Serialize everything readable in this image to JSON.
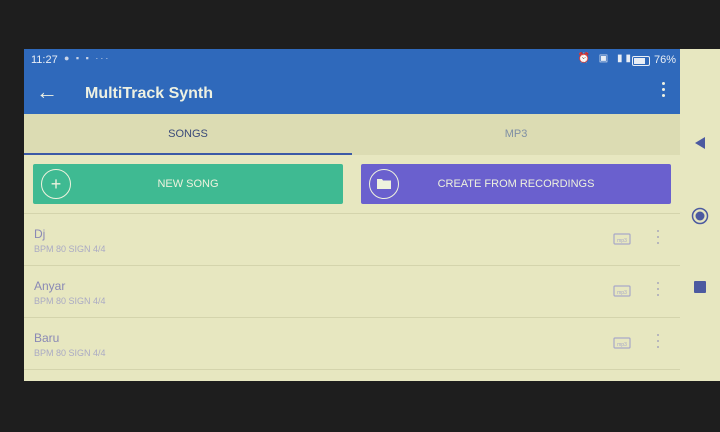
{
  "status_bar": {
    "time": "11:27",
    "notifications": "● ▪ ▪ ···",
    "system_icons": "⏰ ▣ ▮▮",
    "battery": "76"
  },
  "app_bar": {
    "title": "MultiTrack Synth"
  },
  "tabs": [
    {
      "label": "SONGS",
      "active": true
    },
    {
      "label": "MP3",
      "active": false
    }
  ],
  "actions": {
    "new_song": "NEW SONG",
    "create_from_recordings": "CREATE FROM RECORDINGS"
  },
  "songs": [
    {
      "name": "Dj",
      "meta": "BPM  80    SIGN  4/4"
    },
    {
      "name": "Anyar",
      "meta": "BPM  80    SIGN  4/4"
    },
    {
      "name": "Baru",
      "meta": "BPM  80    SIGN  4/4"
    }
  ],
  "colors": {
    "primary": "#2f69bb",
    "new_song": "#3fba92",
    "recordings": "#6a60ce",
    "background": "#e7e7c0"
  }
}
